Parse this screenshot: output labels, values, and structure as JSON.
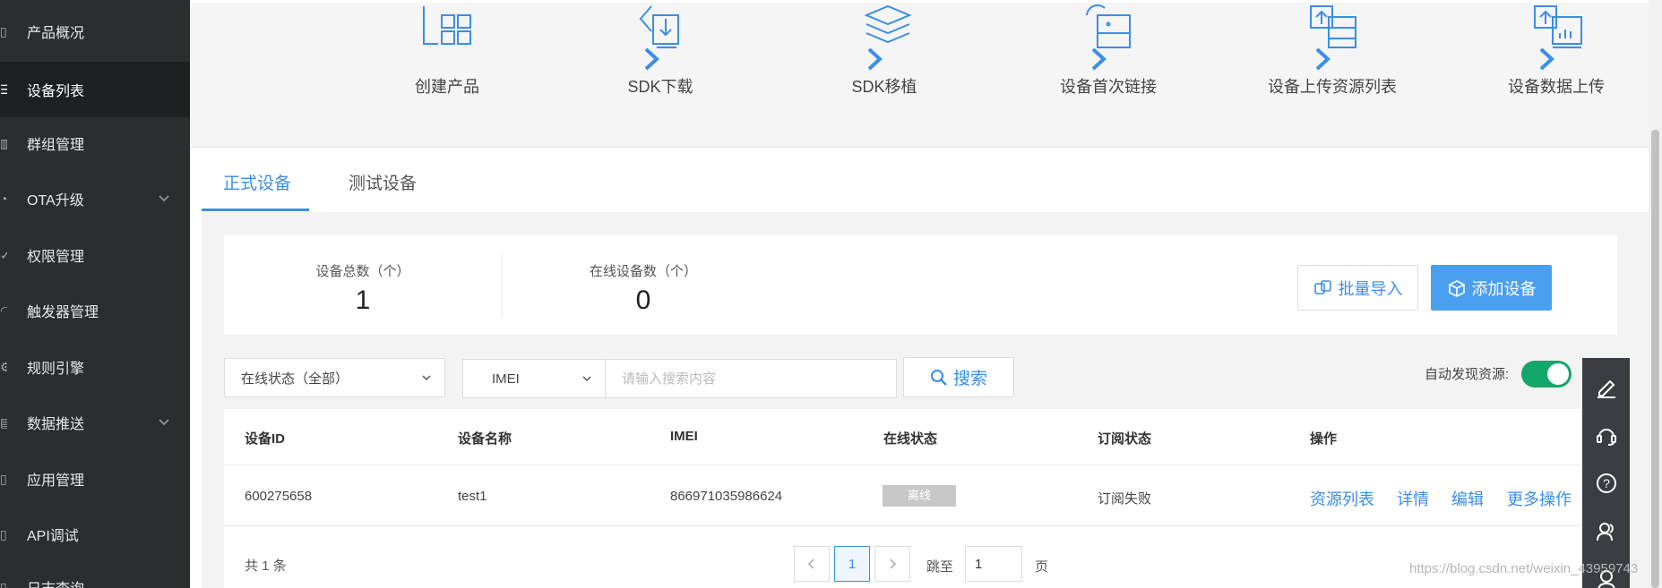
{
  "sidebar": {
    "items": [
      {
        "label": "产品概况",
        "active": false,
        "expandable": false
      },
      {
        "label": "设备列表",
        "active": true,
        "expandable": false
      },
      {
        "label": "群组管理",
        "active": false,
        "expandable": false
      },
      {
        "label": "OTA升级",
        "active": false,
        "expandable": true
      },
      {
        "label": "权限管理",
        "active": false,
        "expandable": false
      },
      {
        "label": "触发器管理",
        "active": false,
        "expandable": false
      },
      {
        "label": "规则引擎",
        "active": false,
        "expandable": false
      },
      {
        "label": "数据推送",
        "active": false,
        "expandable": true
      },
      {
        "label": "应用管理",
        "active": false,
        "expandable": false
      },
      {
        "label": "API调试",
        "active": false,
        "expandable": false
      },
      {
        "label": "日志查询",
        "active": false,
        "expandable": false
      }
    ]
  },
  "steps": [
    {
      "label": "创建产品",
      "icon": "create-product-icon"
    },
    {
      "label": "SDK下载",
      "icon": "sdk-download-icon"
    },
    {
      "label": "SDK移植",
      "icon": "sdk-port-icon"
    },
    {
      "label": "设备首次链接",
      "icon": "device-first-link-icon"
    },
    {
      "label": "设备上传资源列表",
      "icon": "device-upload-resources-icon"
    },
    {
      "label": "设备数据上传",
      "icon": "device-data-upload-icon"
    }
  ],
  "tabs": [
    {
      "label": "正式设备",
      "active": true
    },
    {
      "label": "测试设备",
      "active": false
    }
  ],
  "stats": {
    "total_label": "设备总数（个）",
    "total_value": "1",
    "online_label": "在线设备数（个）",
    "online_value": "0"
  },
  "actions": {
    "import_label": "批量导入",
    "add_label": "添加设备"
  },
  "filters": {
    "status_value": "在线状态（全部）",
    "field_value": "IMEI",
    "search_placeholder": "请输入搜索内容",
    "search_label": "搜索",
    "auto_discover_label": "自动发现资源:",
    "auto_discover_on": true
  },
  "table": {
    "columns": [
      "设备ID",
      "设备名称",
      "IMEI",
      "在线状态",
      "订阅状态",
      "操作"
    ],
    "rows": [
      {
        "device_id": "600275658",
        "device_name": "test1",
        "imei": "866971035986624",
        "online_status": "离线",
        "subscription": "订阅失败",
        "operations": [
          "资源列表",
          "详情",
          "编辑",
          "更多操作"
        ]
      }
    ]
  },
  "pagination": {
    "total": "共 1 条",
    "current_page": "1",
    "jump_label": "跳至",
    "jump_value": "1",
    "page_suffix": "页"
  },
  "watermark": "https://blog.csdn.net/weixin_43959743",
  "colors": {
    "accent": "#3a8ee6",
    "sidebar_bg": "#2b2d30",
    "toggle_on": "#13a66b"
  }
}
